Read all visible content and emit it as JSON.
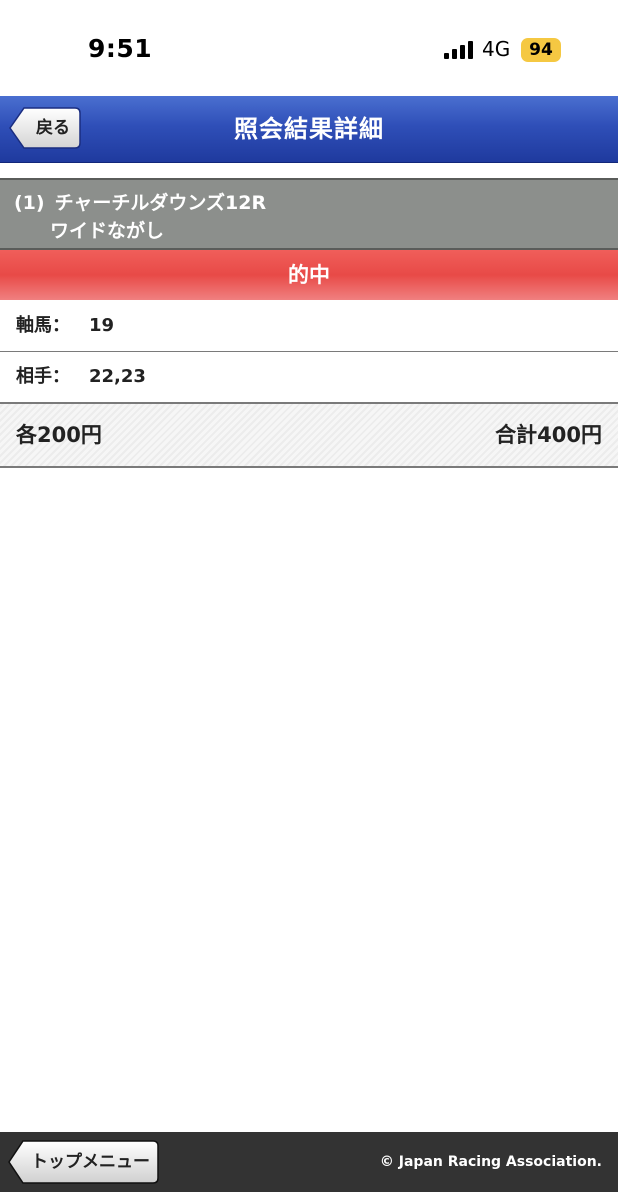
{
  "status_bar": {
    "time": "9:51",
    "network": "4G",
    "battery": "94",
    "battery_color": "#f5c842"
  },
  "header": {
    "back_label": "戻る",
    "title": "照会結果詳細",
    "bar_color": "#2f4fb8"
  },
  "race": {
    "number": "(1)",
    "name": "チャーチルダウンズ12R",
    "bet_type": "ワイドながし"
  },
  "result": {
    "label": "的中",
    "color": "#e84a47"
  },
  "rows": [
    {
      "label": "軸馬：",
      "value": "19"
    },
    {
      "label": "相手：",
      "value": "22,23"
    }
  ],
  "amount": {
    "each": "各200円",
    "total": "合計400円"
  },
  "footer": {
    "top_menu_label": "トップメニュー",
    "copyright": "© Japan Racing Association."
  }
}
